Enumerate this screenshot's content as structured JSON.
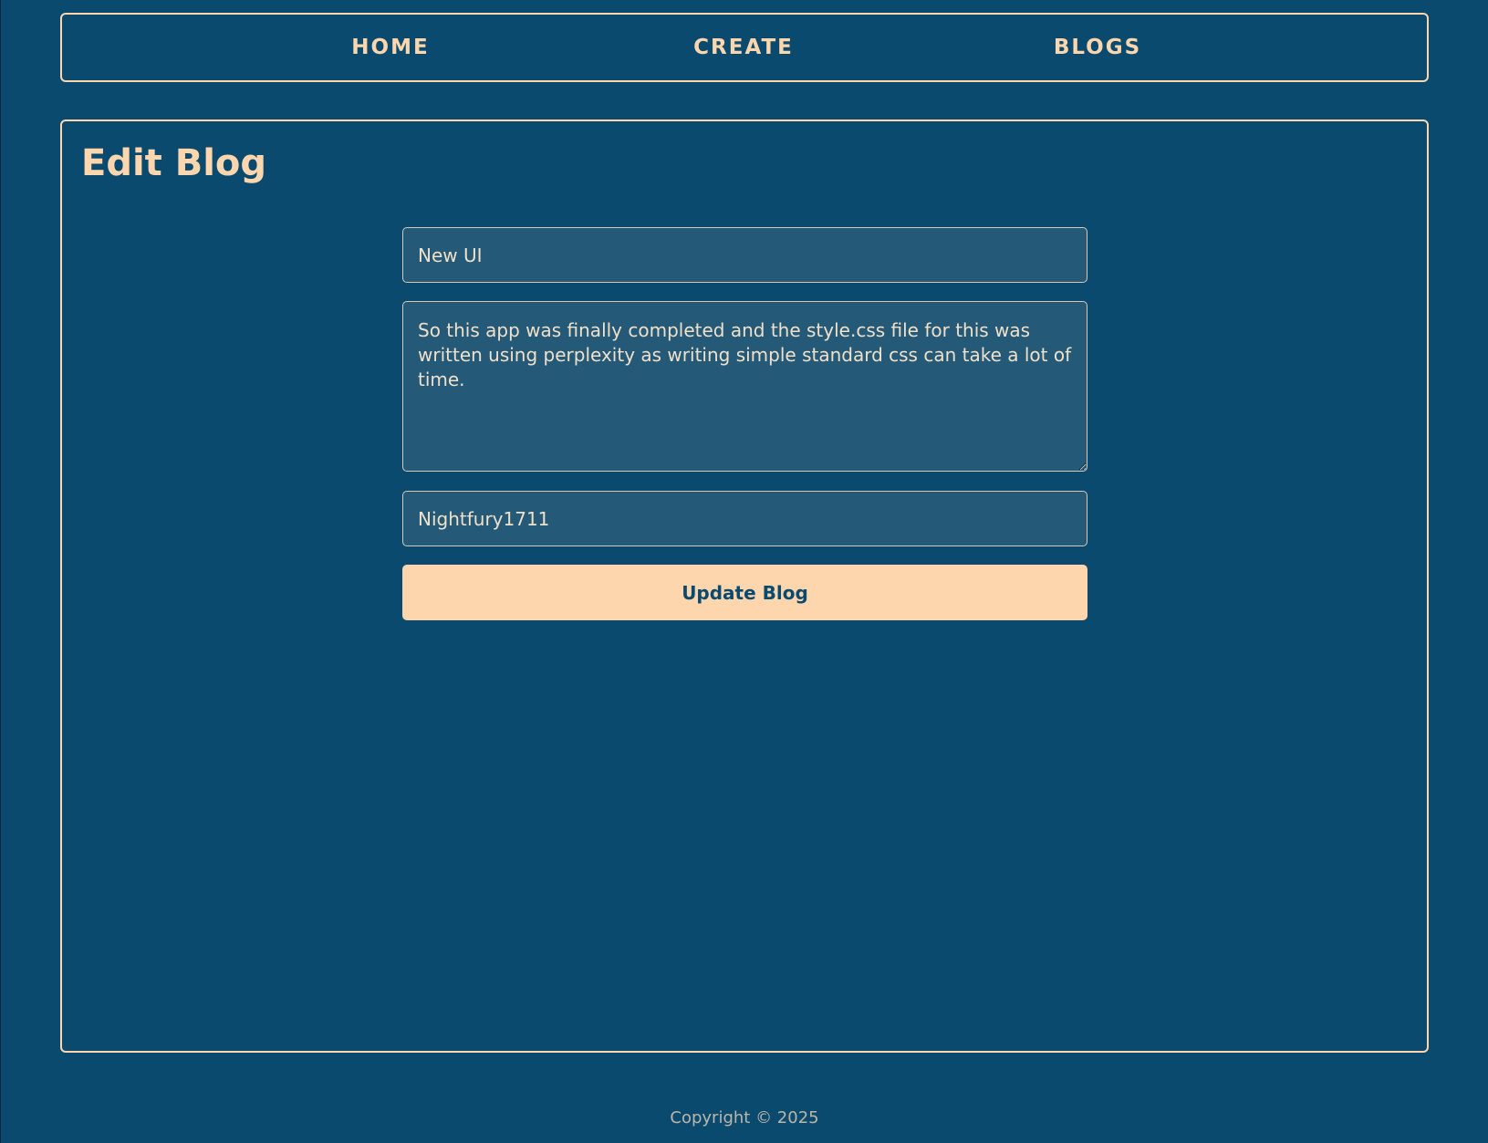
{
  "nav": {
    "links": [
      {
        "label": "HOME"
      },
      {
        "label": "CREATE"
      },
      {
        "label": "BLOGS"
      }
    ]
  },
  "page": {
    "title": "Edit Blog"
  },
  "form": {
    "title_value": "New UI",
    "body_value": "So this app was finally completed and the style.css file for this was written using perplexity as writing simple standard css can take a lot of time.",
    "author_value": "Nightfury1711",
    "submit_label": "Update Blog"
  },
  "footer": {
    "text": "Copyright © 2025"
  },
  "colors": {
    "background": "#0a4a6f",
    "accent": "#fed6ad",
    "field_background": "#245a77"
  }
}
